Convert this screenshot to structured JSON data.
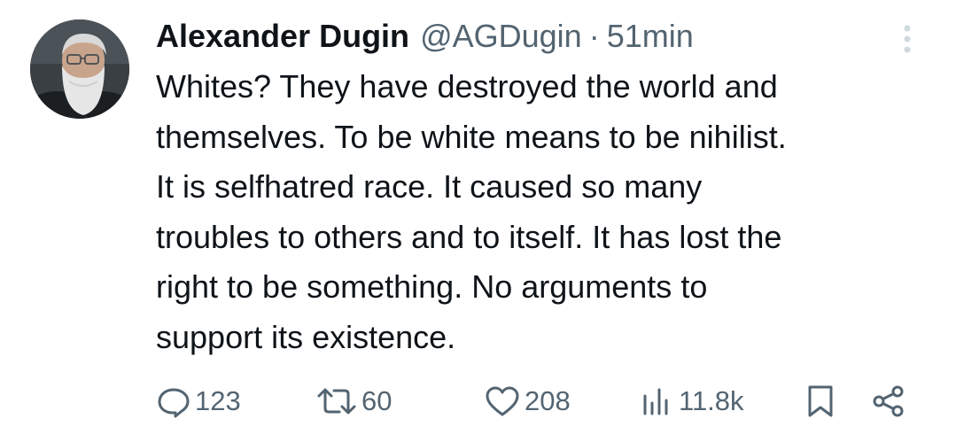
{
  "tweet": {
    "author": {
      "display_name": "Alexander Dugin",
      "handle": "@AGDugin"
    },
    "separator": "·",
    "timestamp": "51min",
    "text": "Whites? They have destroyed the world and\nthemselves. To be white means to be nihilist.\nIt is selfhatred race. It caused so many\ntroubles to others and to itself. It has lost the\nright to be something. No arguments to\nsupport its existence.",
    "stats": {
      "replies": "123",
      "retweets": "60",
      "likes": "208",
      "views": "11.8k"
    },
    "icons": {
      "more": "more-vertical-icon",
      "reply": "reply-icon",
      "retweet": "retweet-icon",
      "like": "heart-icon",
      "views": "views-chart-icon",
      "bookmark": "bookmark-icon",
      "share": "share-icon"
    },
    "colors": {
      "text": "#0f1419",
      "secondary": "#536471",
      "more_dots": "#cfd9de"
    }
  }
}
